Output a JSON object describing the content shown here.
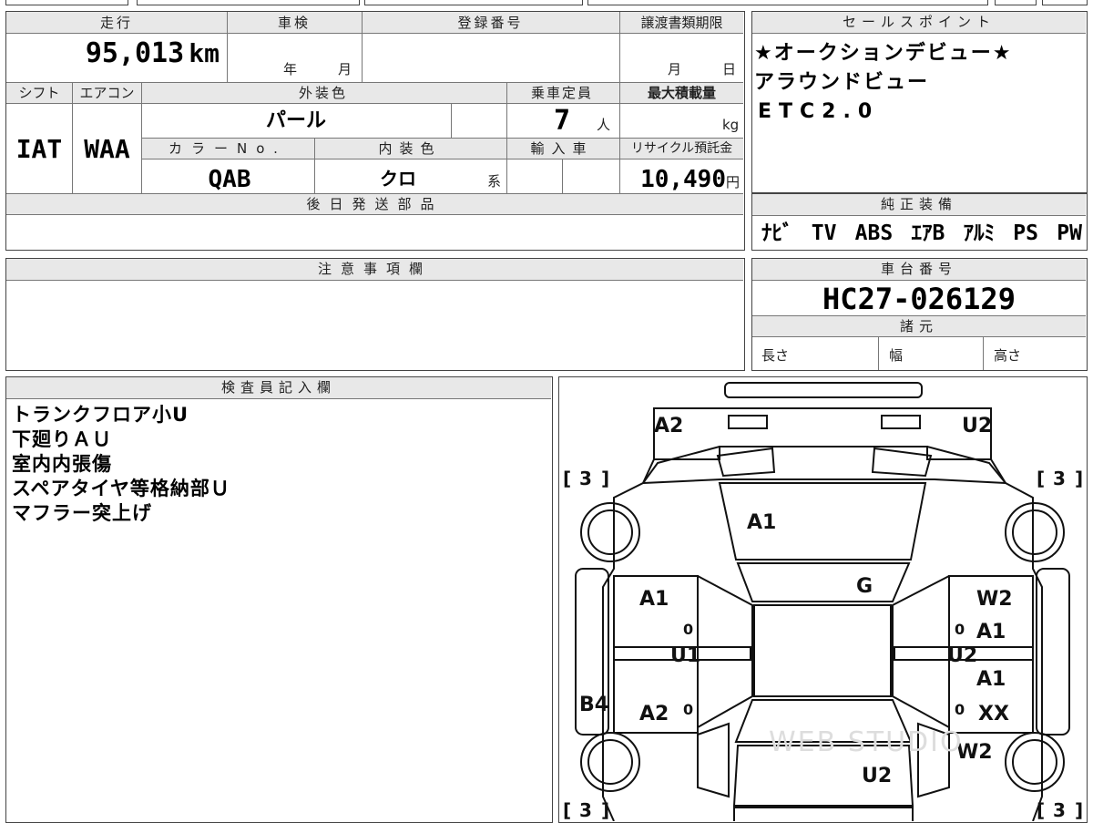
{
  "vehicle_info": {
    "mileage_label": "走行",
    "mileage_value": "95,013",
    "mileage_unit": "km",
    "shaken_label": "車検",
    "shaken_year_unit": "年",
    "shaken_month_unit": "月",
    "registration_label": "登録番号",
    "transfer_deadline_label": "譲渡書類期限",
    "transfer_month_unit": "月",
    "transfer_day_unit": "日",
    "shift_label": "シフト",
    "shift_value": "IAT",
    "aircon_label": "エアコン",
    "aircon_value": "WAA",
    "exterior_color_label": "外装色",
    "exterior_color_value": "パール",
    "capacity_label": "乗車定員",
    "capacity_value": "7",
    "capacity_unit": "人",
    "max_load_label": "最大積載量",
    "max_load_unit": "kg",
    "color_no_label": "カラーNo.",
    "color_no_value": "QAB",
    "interior_color_label": "内装色",
    "interior_color_value": "クロ",
    "interior_color_suffix": "系",
    "import_label": "輸入車",
    "recycle_label": "リサイクル預託金",
    "recycle_value": "10,490",
    "recycle_unit": "円",
    "later_parts_label": "後日発送部品"
  },
  "sales_points": {
    "label": "セールスポイント",
    "lines": [
      "★オークションデビュー★",
      "アラウンドビュー",
      "ETC2.0"
    ]
  },
  "genuine_equipment": {
    "label": "純正装備",
    "items": [
      "ﾅﾋﾞ",
      "TV",
      "ABS",
      "ｴｱB",
      "ｱﾙﾐ",
      "PS",
      "PW"
    ]
  },
  "notes": {
    "label": "注意事項欄"
  },
  "chassis": {
    "label": "車台番号",
    "value": "HC27-026129"
  },
  "specs": {
    "label": "諸元",
    "length_label": "長さ",
    "width_label": "幅",
    "height_label": "高さ"
  },
  "inspector": {
    "label": "検査員記入欄",
    "lines": [
      "トランクフロア小U",
      "下廻りＡＵ",
      "室内内張傷",
      "スペアタイヤ等格納部Ｕ",
      "マフラー突上げ"
    ]
  },
  "diagram": {
    "marks": {
      "front_left": "A2",
      "front_right": "U2",
      "hood": "A1",
      "windshield": "G",
      "front_left_door": "A1",
      "front_right_door": "W2",
      "right_upper_door": "A1",
      "left_pillar": "U1",
      "right_pillar": "U2",
      "right_mid": "A1",
      "left_rocker": "B4",
      "rear_left_door": "A2",
      "rear_right_door": "XX",
      "rear_right_fender": "W2",
      "roof_rear": "U2"
    },
    "tire_marks": {
      "front_left": "3",
      "front_right": "3",
      "rear_left": "3",
      "rear_right": "3"
    },
    "zero_marks": [
      "0",
      "0",
      "0",
      "0"
    ],
    "watermark": "WEB STUDIO"
  }
}
